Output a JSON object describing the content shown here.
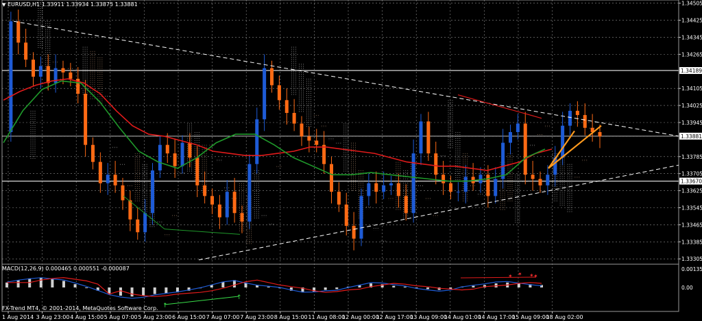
{
  "header": {
    "symbol": "EURUSD,H1",
    "ohlc": "1.33911 1.33934 1.33875 1.33881"
  },
  "macd": {
    "label": "MACD(12,26,9) 0.000465 0.000551 -0.000087",
    "copyright": "FX-Trend MT4, © 2001-2014, MetaQuotes Software Corp."
  },
  "colors": {
    "background": "#000000",
    "grid": "#8f8f8f",
    "bull": "#1e5bd6",
    "bear": "#ff6a14",
    "ma_red": "#e21b1b",
    "ma_green": "#1f9a2b",
    "cloud_bull": "#c8c8c8",
    "cloud_bear": "#c29a7a",
    "trendline": "#ffffff",
    "projection": "#ff9a1e",
    "macd_line": "#1e5bd6",
    "signal_line": "#e21b1b"
  },
  "chart_data": {
    "type": "candlestick",
    "symbol": "EURUSD",
    "timeframe": "H1",
    "price_axis_ticks": [
      "1.34505",
      "1.34425",
      "1.34345",
      "1.34265",
      "1.34189",
      "1.34105",
      "1.34025",
      "1.33945",
      "1.33881",
      "1.33785",
      "1.33705",
      "1.33670",
      "1.33625",
      "1.33545",
      "1.33465",
      "1.33385",
      "1.33305"
    ],
    "price_range": [
      1.3328,
      1.3452
    ],
    "marked_levels": [
      {
        "price": 1.34189,
        "label": "1.34189",
        "style": "horizontal"
      },
      {
        "price": 1.33881,
        "label": "1.33881",
        "style": "current"
      },
      {
        "price": 1.3367,
        "label": "1.33670",
        "style": "horizontal"
      }
    ],
    "time_axis_ticks": [
      "1 Aug 2014",
      "3 Aug 23:00",
      "4 Aug 15:00",
      "5 Aug 07:00",
      "5 Aug 23:00",
      "6 Aug 15:00",
      "7 Aug 07:00",
      "7 Aug 23:00",
      "8 Aug 15:00",
      "11 Aug 08:00",
      "12 Aug 00:00",
      "12 Aug 17:00",
      "13 Aug 09:00",
      "14 Aug 01:00",
      "14 Aug 17:00",
      "15 Aug 09:00",
      "18 Aug 02:00"
    ],
    "price_path": [
      1.339,
      1.3442,
      1.3432,
      1.3424,
      1.3416,
      1.3421,
      1.3413,
      1.342,
      1.3418,
      1.3415,
      1.3408,
      1.3384,
      1.3376,
      1.3366,
      1.337,
      1.3365,
      1.3358,
      1.3349,
      1.3343,
      1.3352,
      1.3372,
      1.3384,
      1.338,
      1.3374,
      1.3385,
      1.3378,
      1.3365,
      1.336,
      1.3356,
      1.335,
      1.3362,
      1.3352,
      1.3348,
      1.3375,
      1.3396,
      1.342,
      1.3412,
      1.3405,
      1.3399,
      1.3394,
      1.3388,
      1.3386,
      1.3384,
      1.3375,
      1.3362,
      1.3356,
      1.3346,
      1.334,
      1.336,
      1.3366,
      1.3362,
      1.3365,
      1.3366,
      1.336,
      1.3352,
      1.338,
      1.3395,
      1.338,
      1.337,
      1.3366,
      1.3362,
      1.3362,
      1.3369,
      1.3366,
      1.337,
      1.336,
      1.3368,
      1.3385,
      1.339,
      1.3394,
      1.337,
      1.3368,
      1.3365,
      1.337,
      1.3378,
      1.3393,
      1.34,
      1.3398,
      1.3392,
      1.339,
      1.3388
    ],
    "ma_red": [
      1.3405,
      1.3409,
      1.3412,
      1.3414,
      1.3415,
      1.3413,
      1.3408,
      1.34,
      1.3393,
      1.3389,
      1.3388,
      1.3386,
      1.3384,
      1.3381,
      1.338,
      1.3379,
      1.3379,
      1.338,
      1.3381,
      1.3383,
      1.3383,
      1.3382,
      1.3381,
      1.338,
      1.3378,
      1.3376,
      1.3375,
      1.3374,
      1.3374,
      1.3373,
      1.3372,
      1.3374,
      1.3376,
      1.338,
      1.3382
    ],
    "ma_green": [
      1.3385,
      1.34,
      1.341,
      1.3414,
      1.3413,
      1.3404,
      1.3392,
      1.3381,
      1.3376,
      1.3373,
      1.3378,
      1.3385,
      1.3389,
      1.3389,
      1.3384,
      1.3378,
      1.3374,
      1.337,
      1.337,
      1.3371,
      1.337,
      1.3369,
      1.3368,
      1.3367,
      1.3367,
      1.3368,
      1.337,
      1.3378,
      1.3382
    ],
    "macd_levels": [
      "0.001352",
      "0.00"
    ],
    "macd_hist": [
      0.6,
      0.9,
      1.1,
      1.2,
      1.0,
      0.8,
      0.4,
      0.0,
      -0.4,
      -0.8,
      -1.0,
      -1.1,
      -1.0,
      -0.8,
      -0.7,
      -0.6,
      -0.4,
      -0.1,
      0.3,
      0.7,
      0.9,
      0.6,
      0.3,
      0.1,
      -0.1,
      -0.4,
      -0.6,
      -0.5,
      -0.3,
      -0.2,
      0.1,
      0.3,
      0.5,
      0.4,
      0.2,
      0.1,
      -0.1,
      -0.2,
      -0.3,
      -0.2,
      0.1,
      0.2,
      0.3,
      0.5,
      0.6,
      0.5,
      0.4,
      0.3
    ]
  }
}
